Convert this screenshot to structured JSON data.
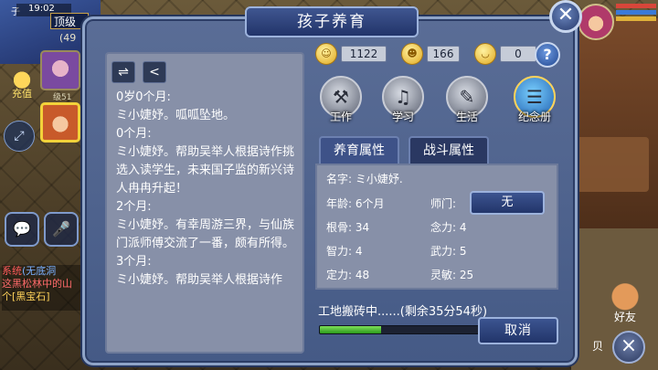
{
  "hud": {
    "zi": "子",
    "time": "19:02",
    "rank": "顶级",
    "count": "(49",
    "recharge": "充值",
    "level_tag": "级51"
  },
  "chat": {
    "lines": [
      {
        "tag": "系统",
        "text": "(无底洞",
        "tag_color": "#ff5a5a",
        "text_color": "#7ab0ff"
      },
      {
        "tag": "",
        "text": "这黑松林中的山",
        "tag_color": "#ff6a6a",
        "text_color": "#ff6a6a"
      },
      {
        "tag": "个",
        "text": "[黑宝石]",
        "tag_color": "#ffd35a",
        "text_color": "#ffd35a"
      }
    ]
  },
  "right_hud": {
    "friends": "好友",
    "equipment_fragment": "贝"
  },
  "dialog": {
    "title": "孩子养育",
    "close_glyph": "✕"
  },
  "currency": [
    {
      "icon": "coin-smile-icon",
      "glyph": "☺",
      "value": "1122"
    },
    {
      "icon": "coin-face-icon",
      "glyph": "☻",
      "value": "166"
    },
    {
      "icon": "coin-content-icon",
      "glyph": "◡",
      "value": "0"
    }
  ],
  "help": "?",
  "log_toolbar": {
    "swap_glyph": "⇌",
    "share_glyph": "<"
  },
  "log": [
    "0岁0个月:",
    "ミ小婕妤。呱呱坠地。",
    "0个月:",
    "ミ小婕妤。帮助吴举人根据诗作挑选入读学生，未来国子监的新兴诗人冉冉升起！",
    "2个月:",
    "ミ小婕妤。有幸周游三界，与仙族门派师傅交流了一番，颇有所得。",
    "3个月:",
    "ミ小婕妤。帮助吴举人根据诗作"
  ],
  "actions": [
    {
      "name": "work",
      "label": "工作",
      "icon": "anvil-icon",
      "glyph": "⚒"
    },
    {
      "name": "study",
      "label": "学习",
      "icon": "lute-icon",
      "glyph": "♫"
    },
    {
      "name": "life",
      "label": "生活",
      "icon": "tools-icon",
      "glyph": "✎"
    },
    {
      "name": "album",
      "label": "纪念册",
      "icon": "album-icon",
      "glyph": "☰"
    }
  ],
  "tabs": [
    {
      "label": "养育属性",
      "active": true
    },
    {
      "label": "战斗属性",
      "active": false
    }
  ],
  "attributes": {
    "name_label": "名字:",
    "name_value": "ミ小婕妤.",
    "age_label": "年龄:",
    "age_value": "6个月",
    "master_label": "师门:",
    "master_value": "无",
    "gengu_label": "根骨:",
    "gengu_value": "34",
    "nianli_label": "念力:",
    "nianli_value": "4",
    "zhili_label": "智力:",
    "zhili_value": "4",
    "wuli_label": "武力:",
    "wuli_value": "5",
    "dingli_label": "定力:",
    "dingli_value": "48",
    "lingmin_label": "灵敏:",
    "lingmin_value": "25"
  },
  "progress": {
    "label": "工地搬砖中......(剩余35分54秒)",
    "fraction": 0.38
  },
  "cancel_label": "取消",
  "colors": {
    "dialog_bg": "#4e6290",
    "panel_bg": "#8790a8",
    "progress_fill": "#4fc02e",
    "accent_gold": "#f3d23a"
  }
}
